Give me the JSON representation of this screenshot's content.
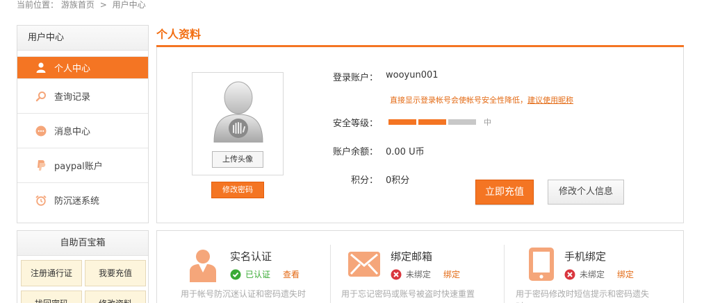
{
  "breadcrumb": {
    "prefix": "当前位置：",
    "home": "游族首页",
    "sep": ">",
    "current": "用户中心"
  },
  "sidebar": {
    "title": "用户中心",
    "items": [
      {
        "label": "个人中心",
        "icon": "user-icon",
        "active": true
      },
      {
        "label": "查询记录",
        "icon": "search-icon",
        "active": false
      },
      {
        "label": "消息中心",
        "icon": "message-icon",
        "active": false
      },
      {
        "label": "paypal账户",
        "icon": "paypal-icon",
        "active": false
      },
      {
        "label": "防沉迷系统",
        "icon": "alarm-clock-icon",
        "active": false
      }
    ]
  },
  "profile": {
    "title": "个人资料",
    "upload_label": "上传头像",
    "change_password_label": "修改密码",
    "account_label": "登录账户：",
    "account_value": "wooyun001",
    "warning_text": "直接显示登录帐号会使帐号安全性降低，",
    "warning_link": "建议使用昵称",
    "security_label": "安全等级：",
    "security_level_text": "中",
    "security_filled_segments": 2,
    "security_total_segments": 3,
    "balance_label": "账户余额：",
    "balance_value": "0.00 U币",
    "points_label": "积分：",
    "points_value": "0积分",
    "charge_label": "立即充值",
    "edit_info_label": "修改个人信息"
  },
  "toolbox": {
    "title": "自助百宝箱",
    "buttons": [
      "注册通行证",
      "我要充值",
      "找回密码",
      "修改资料"
    ]
  },
  "bindings": [
    {
      "title": "实名认证",
      "icon": "person-icon",
      "status_icon": "check-circle-icon",
      "status": "已认证",
      "action": "查看",
      "desc": "用于帐号防沉迷认证和密码遗失时",
      "status_color": "#3aaa35"
    },
    {
      "title": "绑定邮箱",
      "icon": "envelope-icon",
      "status_icon": "x-circle-icon",
      "status": "未绑定",
      "action": "绑定",
      "desc": "用于忘记密码或账号被盗时快速重置",
      "status_color": "#666666"
    },
    {
      "title": "手机绑定",
      "icon": "mobile-phone-icon",
      "status_icon": "x-circle-icon",
      "status": "未绑定",
      "action": "绑定",
      "desc": "用于密码修改时短信提示和密码遗失时",
      "status_color": "#666666"
    }
  ],
  "colors": {
    "accent": "#f47523",
    "accent_text": "#f26d11",
    "icon_peach": "#f5a67a",
    "ok_green": "#3aaa35",
    "fail_red": "#d9363e",
    "bar_empty": "#c8c8c8"
  }
}
